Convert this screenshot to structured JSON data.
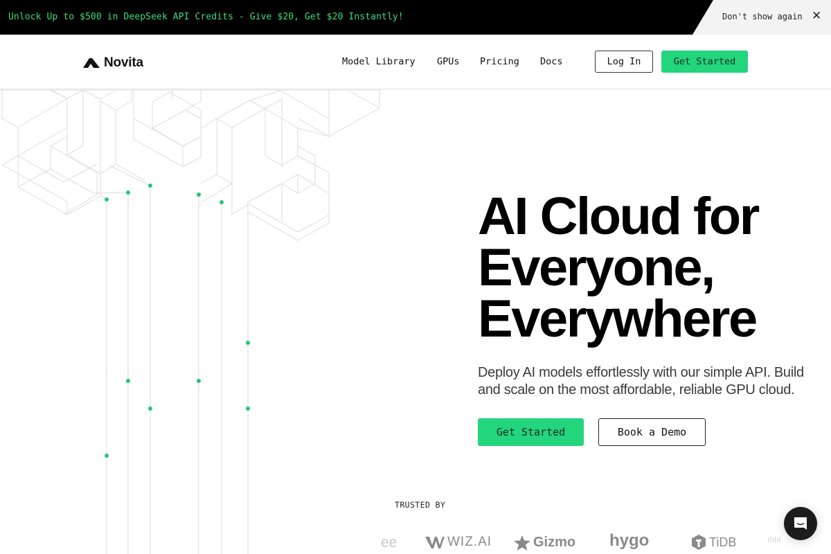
{
  "banner": {
    "promo_text": "Unlock Up to $500 in DeepSeek API Credits - Give $20, Get $20 Instantly!",
    "dont_show_label": "Don't show again",
    "close_icon": "✕"
  },
  "header": {
    "brand": "Novita",
    "nav": [
      {
        "label": "Model Library"
      },
      {
        "label": "GPUs"
      },
      {
        "label": "Pricing"
      },
      {
        "label": "Docs"
      }
    ],
    "login_label": "Log In",
    "get_started_label": "Get Started"
  },
  "hero": {
    "title_lines": [
      "AI Cloud for",
      "Everyone,",
      "Everywhere"
    ],
    "subtitle": "Deploy AI models effortlessly with our simple API. Build and scale on the most affordable, reliable GPU cloud.",
    "primary_cta": "Get Started",
    "secondary_cta": "Book a Demo"
  },
  "trusted": {
    "label": "TRUSTED BY",
    "logos": [
      {
        "name": "ee"
      },
      {
        "name": "WIZ.AI"
      },
      {
        "name": "Gizmo"
      },
      {
        "name": "hygo"
      },
      {
        "name": "TiDB"
      },
      {
        "name": "ıIıIıl"
      }
    ]
  },
  "colors": {
    "accent": "#23d57c",
    "banner_text": "#3ddc84",
    "banner_bg": "#000000",
    "line": "#dcdcdc"
  }
}
